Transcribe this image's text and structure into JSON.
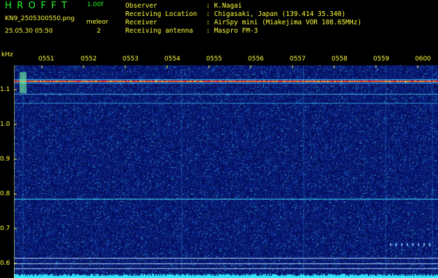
{
  "header": {
    "app_title": "HROFFT",
    "version": "1.00f",
    "filename": "KN9_2505300550.png",
    "station": "meleor",
    "timestamp": "25.05.30 05:50",
    "count": "2"
  },
  "info": [
    {
      "label": "Observer",
      "value": ": K.Nagai"
    },
    {
      "label": "Receiving Location",
      "value": ": Chigasaki, Japan (139.414 35.340)"
    },
    {
      "label": "Receiver",
      "value": ": AirSpy mini (Miakejima VOR 108.65MHz)"
    },
    {
      "label": "Receiving antenna",
      "value": ": Maspro FM-3"
    }
  ],
  "axes": {
    "y_unit": "kHz",
    "x_ticks": [
      "0551",
      "0552",
      "0553",
      "0554",
      "0555",
      "0556",
      "0557",
      "0558",
      "0559",
      "0600"
    ],
    "y_ticks": [
      "1.1",
      "1.0",
      "0.9",
      "0.8",
      "0.7",
      "0.6"
    ]
  },
  "colors": {
    "background": "#000000",
    "text_yellow": "#ffff3a",
    "text_green": "#22ff22",
    "plot_background": "#06126a",
    "carrier_red": "#ff3030",
    "line_cyan": "#40e0ff"
  }
}
